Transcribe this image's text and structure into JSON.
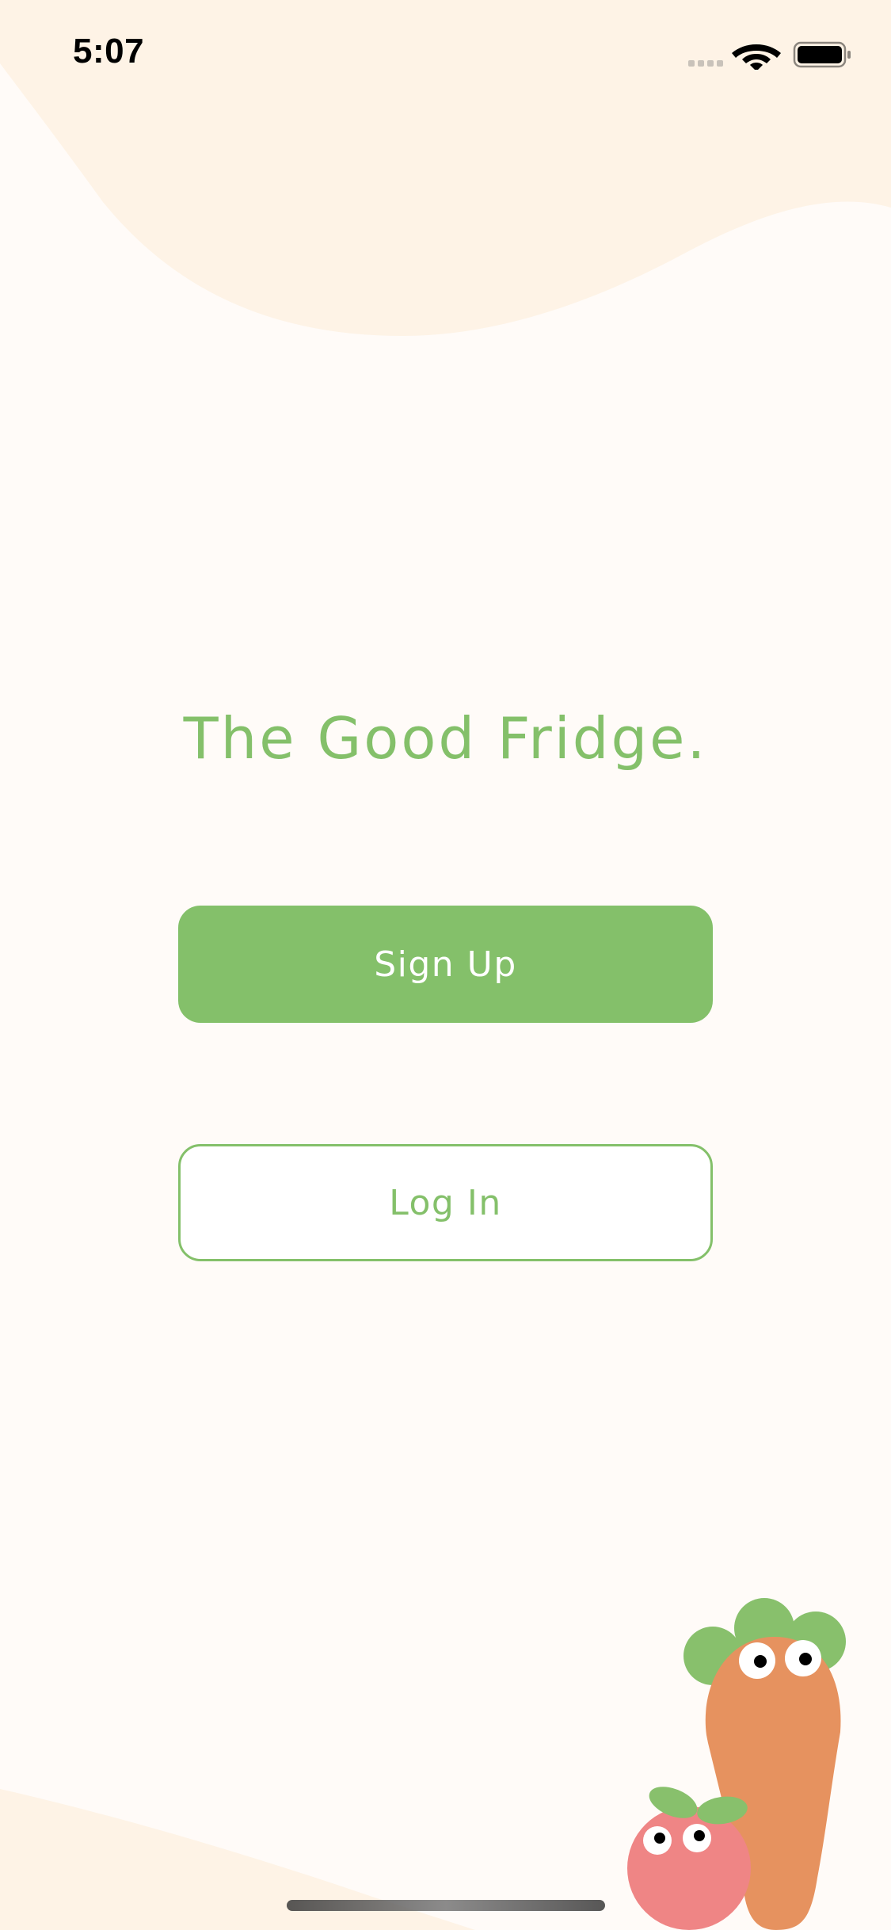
{
  "status_bar": {
    "time": "5:07",
    "icons": [
      "signal-dots-icon",
      "wifi-icon",
      "battery-icon"
    ]
  },
  "main": {
    "title": "The Good Fridge.",
    "signup_label": "Sign Up",
    "login_label": "Log In"
  },
  "illustration": {
    "characters": [
      "carrot-mascot",
      "tomato-mascot"
    ]
  },
  "colors": {
    "accent_green": "#84c06a",
    "background": "#fffbf8",
    "wave_peach": "#fef3e6",
    "carrot_orange": "#e6925f",
    "tomato_pink": "#ef8585"
  }
}
